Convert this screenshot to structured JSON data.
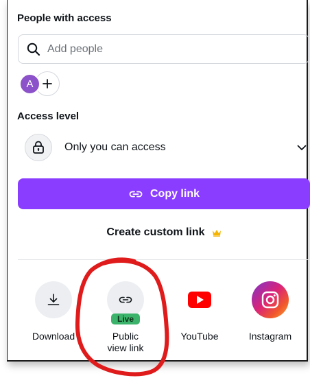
{
  "people": {
    "title": "People with access",
    "search_placeholder": "Add people",
    "avatar_initial": "A"
  },
  "access": {
    "title": "Access level",
    "value": "Only you can access"
  },
  "actions": {
    "copy_link": "Copy link",
    "custom_link": "Create custom link"
  },
  "share_options": {
    "download": "Download",
    "public_view": "Public view link",
    "live_badge": "Live",
    "youtube": "YouTube",
    "instagram": "Instagram"
  },
  "colors": {
    "primary": "#8b3dff",
    "avatar": "#8c52c9",
    "live": "#3bb36a",
    "youtube": "#ff0000",
    "annotation": "#e01b1b"
  }
}
